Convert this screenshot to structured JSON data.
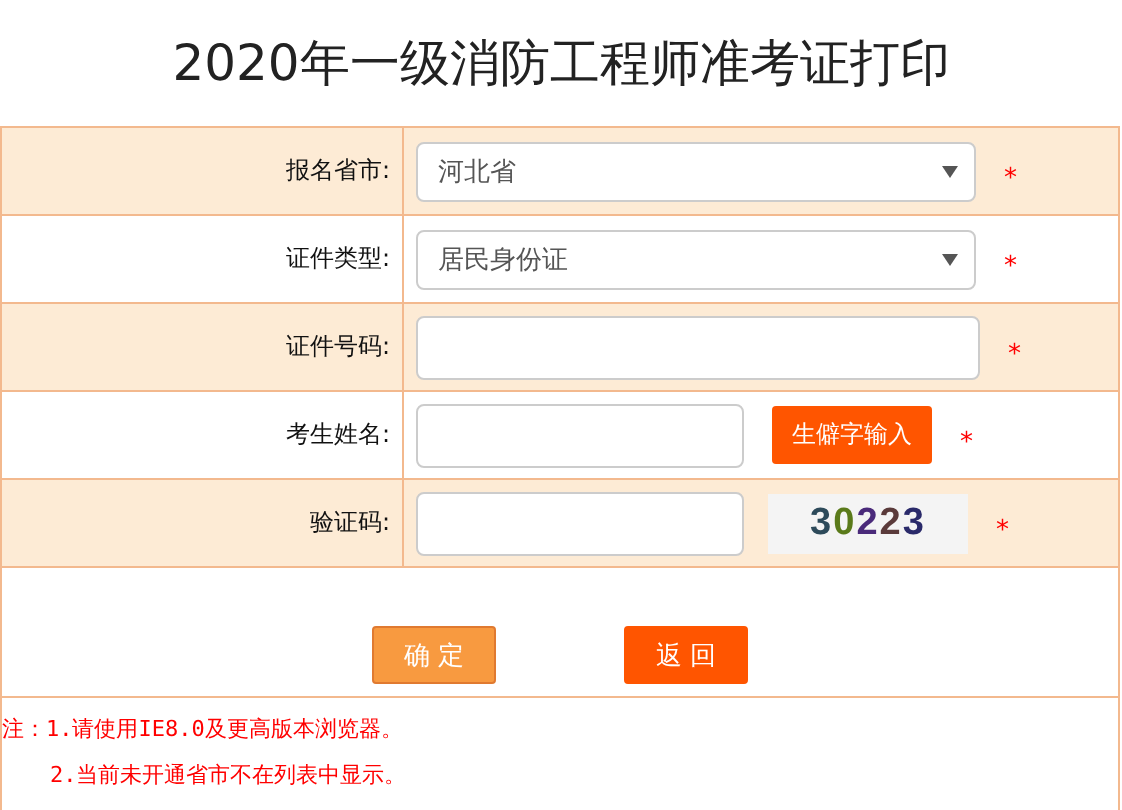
{
  "title": "2020年一级消防工程师准考证打印",
  "rows": [
    {
      "kind": "select",
      "label": "报名省市:",
      "value": "河北省",
      "required": "*"
    },
    {
      "kind": "select",
      "label": "证件类型:",
      "value": "居民身份证",
      "required": "*"
    },
    {
      "kind": "input",
      "label": "证件号码:",
      "required": "*"
    },
    {
      "kind": "input_button",
      "label": "考生姓名:",
      "button": "生僻字输入",
      "required": "*"
    },
    {
      "kind": "captcha",
      "label": "验证码:",
      "captcha": "30223",
      "required": "*"
    }
  ],
  "buttons": [
    {
      "label": "确 定",
      "kind": "confirm"
    },
    {
      "label": "返 回",
      "kind": "back"
    }
  ],
  "notes": [
    "注：1.请使用IE8.0及更高版本浏览器。",
    "2.当前未开通省市不在列表中显示。"
  ]
}
